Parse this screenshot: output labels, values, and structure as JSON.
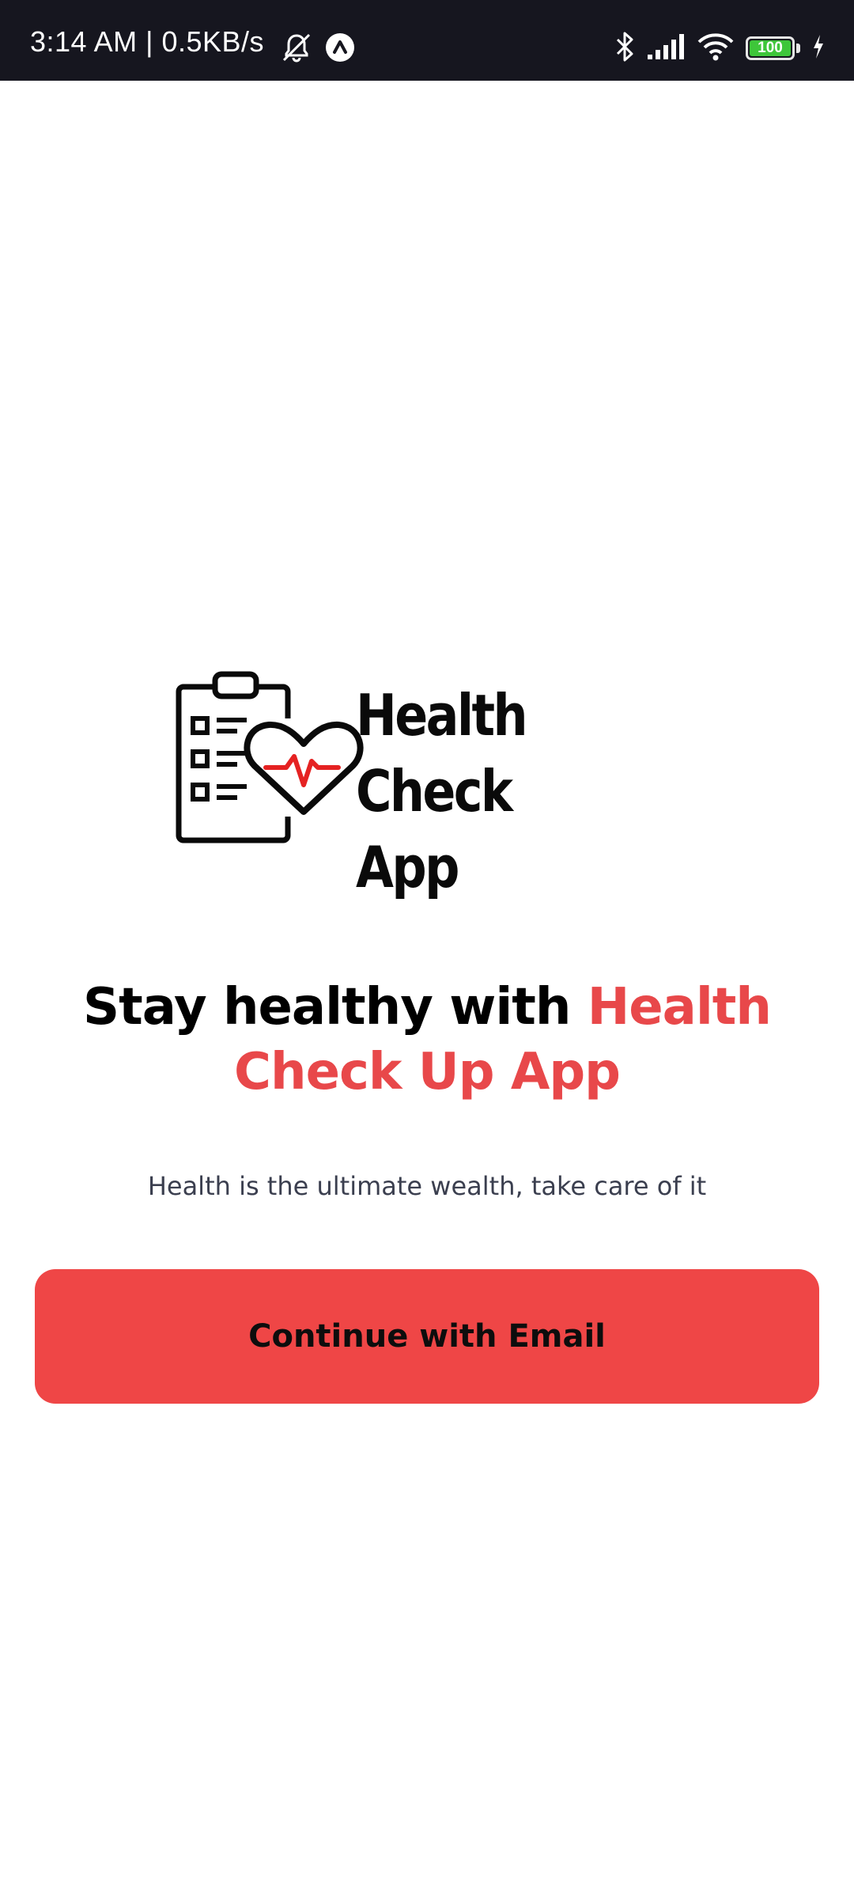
{
  "status_bar": {
    "time_text": "3:14 AM | 0.5KB/s",
    "battery_level": "100",
    "icons": [
      "mute-alarm-icon",
      "app-notification-icon",
      "bluetooth-icon",
      "signal-icon",
      "wifi-icon",
      "battery-icon",
      "charging-icon"
    ]
  },
  "logo": {
    "line1": "Health Check",
    "line2": "App"
  },
  "headline": {
    "prefix": "Stay healthy with ",
    "accent": "Health Check Up App"
  },
  "tagline": "Health is the ultimate wealth, take care of it",
  "cta": {
    "label": "Continue with Email"
  },
  "colors": {
    "status_bar_bg": "#16161f",
    "accent": "#e8484a",
    "button": "#ef4646",
    "battery_fill": "#3ec63a"
  }
}
